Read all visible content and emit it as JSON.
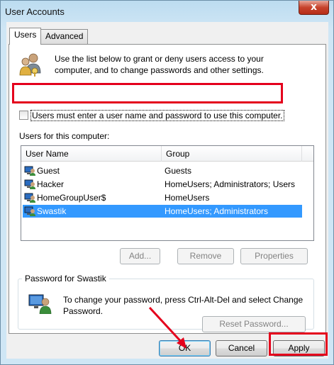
{
  "window": {
    "title": "User Accounts",
    "close_label": "x"
  },
  "tabs": [
    {
      "label": "Users",
      "active": true
    },
    {
      "label": "Advanced",
      "active": false
    }
  ],
  "description": "Use the list below to grant or deny users access to your computer, and to change passwords and other settings.",
  "require_login": {
    "label": "Users must enter a user name and password to use this computer.",
    "checked": false
  },
  "users_list": {
    "label": "Users for this computer:",
    "columns": [
      "User Name",
      "Group"
    ],
    "rows": [
      {
        "name": "Guest",
        "group": "Guests",
        "selected": false
      },
      {
        "name": "Hacker",
        "group": "HomeUsers; Administrators; Users",
        "selected": false
      },
      {
        "name": "HomeGroupUser$",
        "group": "HomeUsers",
        "selected": false
      },
      {
        "name": "Swastik",
        "group": "HomeUsers; Administrators",
        "selected": true
      }
    ]
  },
  "list_buttons": {
    "add": "Add...",
    "remove": "Remove",
    "properties": "Properties"
  },
  "password_group": {
    "title": "Password for Swastik",
    "text": "To change your password, press Ctrl-Alt-Del and select Change Password.",
    "reset_button": "Reset Password..."
  },
  "dialog_buttons": {
    "ok": "OK",
    "cancel": "Cancel",
    "apply": "Apply"
  },
  "annotation_color": "#e4001c",
  "selection_color": "#3399ff"
}
